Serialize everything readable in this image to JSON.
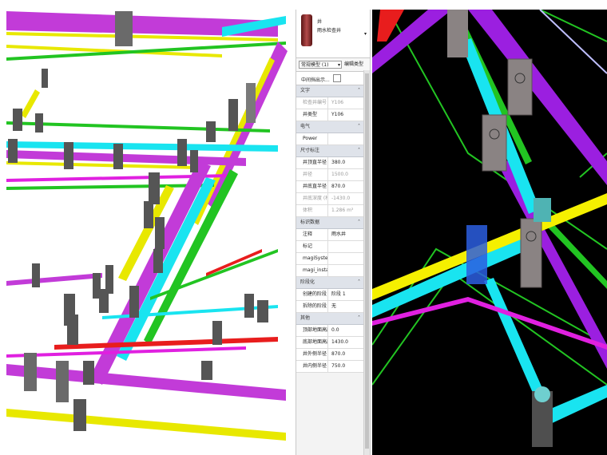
{
  "type_selector": {
    "category": "井",
    "name": "雨水检查井"
  },
  "filter": {
    "selected": "常规模型 (1)",
    "edit_type_label": "编辑类型"
  },
  "visibility": {
    "label": "中间挡出示...",
    "checked": false
  },
  "sections": [
    {
      "title": "文字",
      "rows": [
        {
          "key": "检查井编号",
          "value": "Y106",
          "dim": true
        },
        {
          "key": "井类型",
          "value": "Y106",
          "dim": false
        }
      ]
    },
    {
      "title": "电气",
      "rows": [
        {
          "key": "Power",
          "value": "",
          "dim": false
        }
      ]
    },
    {
      "title": "尺寸标注",
      "rows": [
        {
          "key": "井顶直半径",
          "value": "380.0",
          "dim": false
        },
        {
          "key": "井径",
          "value": "1500.0",
          "dim": true
        },
        {
          "key": "井底直半径",
          "value": "870.0",
          "dim": false
        },
        {
          "key": "井底深度 (相...",
          "value": "-1430.0",
          "dim": true
        },
        {
          "key": "体积",
          "value": "1.286 m³",
          "dim": true
        }
      ]
    },
    {
      "title": "标识数据",
      "rows": [
        {
          "key": "注释",
          "value": "雨水井",
          "dim": false
        },
        {
          "key": "标记",
          "value": "",
          "dim": false
        },
        {
          "key": "magiSystem...",
          "value": "",
          "dim": false
        },
        {
          "key": "magi_installa...",
          "value": "",
          "dim": false
        }
      ]
    },
    {
      "title": "阶段化",
      "rows": [
        {
          "key": "创建的阶段",
          "value": "阶段 1",
          "dim": false
        },
        {
          "key": "拆除的阶段",
          "value": "无",
          "dim": false
        }
      ]
    },
    {
      "title": "其他",
      "rows": [
        {
          "key": "顶部地面高度",
          "value": "0.0",
          "dim": false
        },
        {
          "key": "底部地面高度",
          "value": "1430.0",
          "dim": false
        },
        {
          "key": "井外侧半径",
          "value": "870.0",
          "dim": false
        },
        {
          "key": "井内侧半径",
          "value": "750.0",
          "dim": false
        }
      ]
    }
  ],
  "colors": {
    "cyan": "#19e4f0",
    "purple": "#9b1fe0",
    "yellow": "#f5f000",
    "green": "#22c422",
    "red": "#e81d1d",
    "magenta": "#e020e0",
    "gray": "#6a6a6a"
  }
}
